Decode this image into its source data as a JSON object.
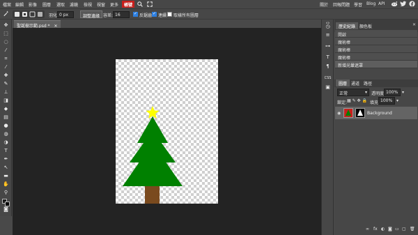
{
  "menu": {
    "items": [
      "檔案",
      "編輯",
      "影像",
      "圖層",
      "選取",
      "濾鏡",
      "檢視",
      "視窗",
      "更多"
    ],
    "special": "帳號",
    "right_links": [
      "關於",
      "回報問題",
      "學習",
      "Blog",
      "API"
    ]
  },
  "options": {
    "feather_label": "羽化:",
    "feather_value": "0 px",
    "refine_edge_button": "調整邊緣",
    "tolerance_label": "容差:",
    "tolerance_value": "16",
    "anti_alias_label": "反鋸齒",
    "anti_alias_checked": true,
    "contiguous_label": "連續",
    "contiguous_checked": true,
    "all_layers_label": "取樣所有圖層",
    "all_layers_checked": false
  },
  "document": {
    "tab_label": "聖誕樹示範.psd *",
    "close_glyph": "✕"
  },
  "history_panel": {
    "tabs": [
      "歷史紀錄",
      "顏色板"
    ],
    "entries": [
      "開啟",
      "魔術棒",
      "魔術棒",
      "魔術棒",
      "新增光暈遮罩"
    ],
    "selected_index": 4
  },
  "layers_panel": {
    "tabs": [
      "圖層",
      "通道",
      "路徑"
    ],
    "blend_mode": "正常",
    "opacity_label": "透明度:",
    "opacity_value": "100%",
    "lock_label": "鎖定:",
    "fill_label": "填充:",
    "fill_value": "100%",
    "layers": [
      {
        "name": "Background"
      }
    ]
  },
  "colors": {
    "tree_green": "#008000",
    "trunk_brown": "#7a4a1e",
    "star_yellow": "#ffff00",
    "menu_highlight": "#c8201d"
  }
}
